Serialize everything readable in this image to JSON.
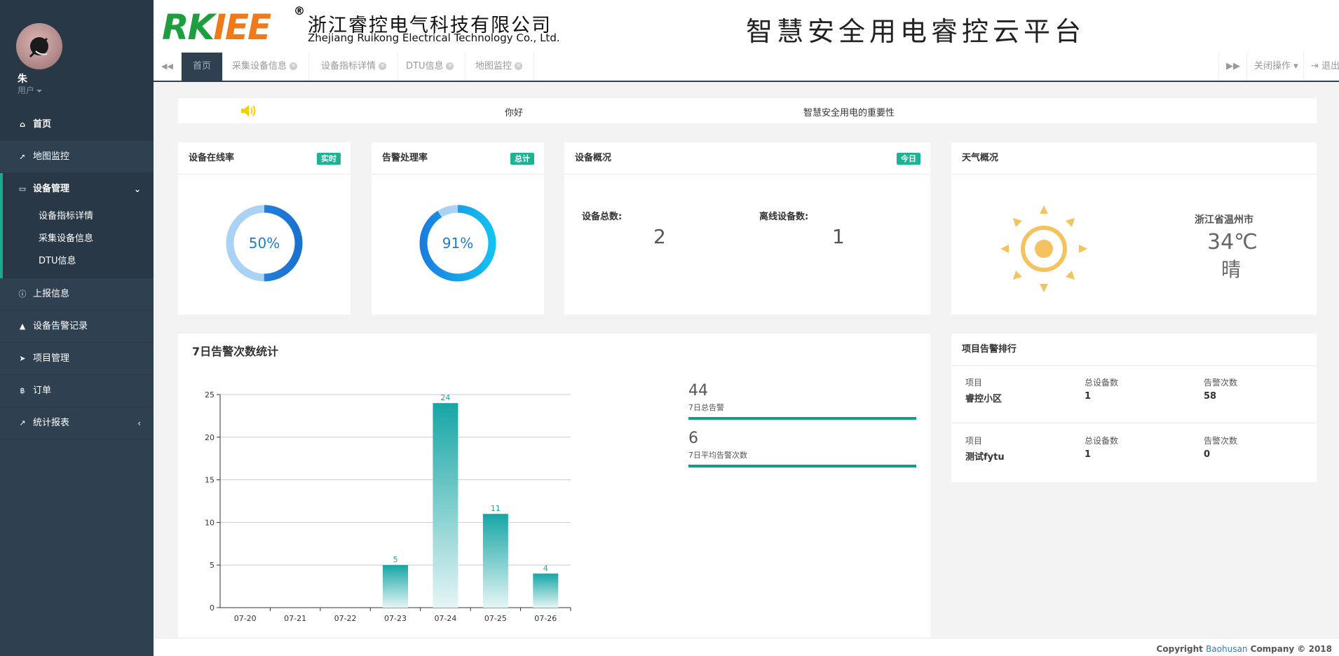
{
  "user": {
    "name": "朱",
    "role": "用户"
  },
  "sidebar": {
    "items": [
      {
        "label": "首页",
        "icon": "home-icon"
      },
      {
        "label": "地图监控",
        "icon": "paper-plane-icon"
      },
      {
        "label": "设备管理",
        "icon": "desktop-icon",
        "children": [
          "设备指标详情",
          "采集设备信息",
          "DTU信息"
        ]
      },
      {
        "label": "上报信息",
        "icon": "info-circle-icon"
      },
      {
        "label": "设备告警记录",
        "icon": "warning-icon"
      },
      {
        "label": "项目管理",
        "icon": "location-arrow-icon"
      },
      {
        "label": "订单",
        "icon": "bitcoin-icon"
      },
      {
        "label": "统计报表",
        "icon": "line-chart-icon"
      }
    ]
  },
  "header": {
    "logo_text_a": "RK",
    "logo_text_b": "IEE",
    "logo_reg": "®",
    "company_cn": "浙江睿控电气科技有限公司",
    "company_en": "Zhejiang Ruikong Electrical Technology Co., Ltd.",
    "platform_title": "智慧安全用电睿控云平台"
  },
  "tabs": {
    "items": [
      "首页",
      "采集设备信息",
      "设备指标详情",
      "DTU信息",
      "地图监控"
    ],
    "close_ops": "关闭操作",
    "logout": "退出"
  },
  "notice": {
    "text1": "你好",
    "text2": "智慧安全用电的重要性"
  },
  "online_rate": {
    "title": "设备在线率",
    "badge": "实时",
    "value_text": "50%",
    "value": 50
  },
  "alarm_rate": {
    "title": "告警处理率",
    "badge": "总计",
    "value_text": "91%",
    "value": 91
  },
  "overview": {
    "title": "设备概况",
    "badge": "今日",
    "total_label": "设备总数:",
    "total": "2",
    "offline_label": "离线设备数:",
    "offline": "1"
  },
  "weather": {
    "title": "天气概况",
    "city": "浙江省温州市",
    "temp": "34℃",
    "cond": "晴"
  },
  "alarm_stats": {
    "title": "7日告警次数统计",
    "total": "44",
    "total_label": "7日总告警",
    "avg": "6",
    "avg_label": "7日平均告警次数"
  },
  "chart_data": {
    "type": "bar",
    "title": "7日告警次数统计",
    "categories": [
      "07-20",
      "07-21",
      "07-22",
      "07-23",
      "07-24",
      "07-25",
      "07-26"
    ],
    "values": [
      0,
      0,
      0,
      5,
      24,
      11,
      4
    ],
    "ylim": [
      0,
      25
    ],
    "yticks": [
      0,
      5,
      10,
      15,
      20,
      25
    ],
    "grid": true
  },
  "ranking": {
    "title": "项目告警排行",
    "headers": [
      "项目",
      "总设备数",
      "告警次数"
    ],
    "rows": [
      [
        "睿控小区",
        "1",
        "58"
      ],
      [
        "测试fytu",
        "1",
        "0"
      ]
    ]
  },
  "footer": {
    "prefix": "Copyright ",
    "company": "Baohusan",
    "suffix": " Company © 2018"
  },
  "colors": {
    "sidebar": "#2f4050",
    "accent": "#1ab394",
    "donut_blue": "#1d7bd8",
    "bar": "#20a8a8"
  }
}
